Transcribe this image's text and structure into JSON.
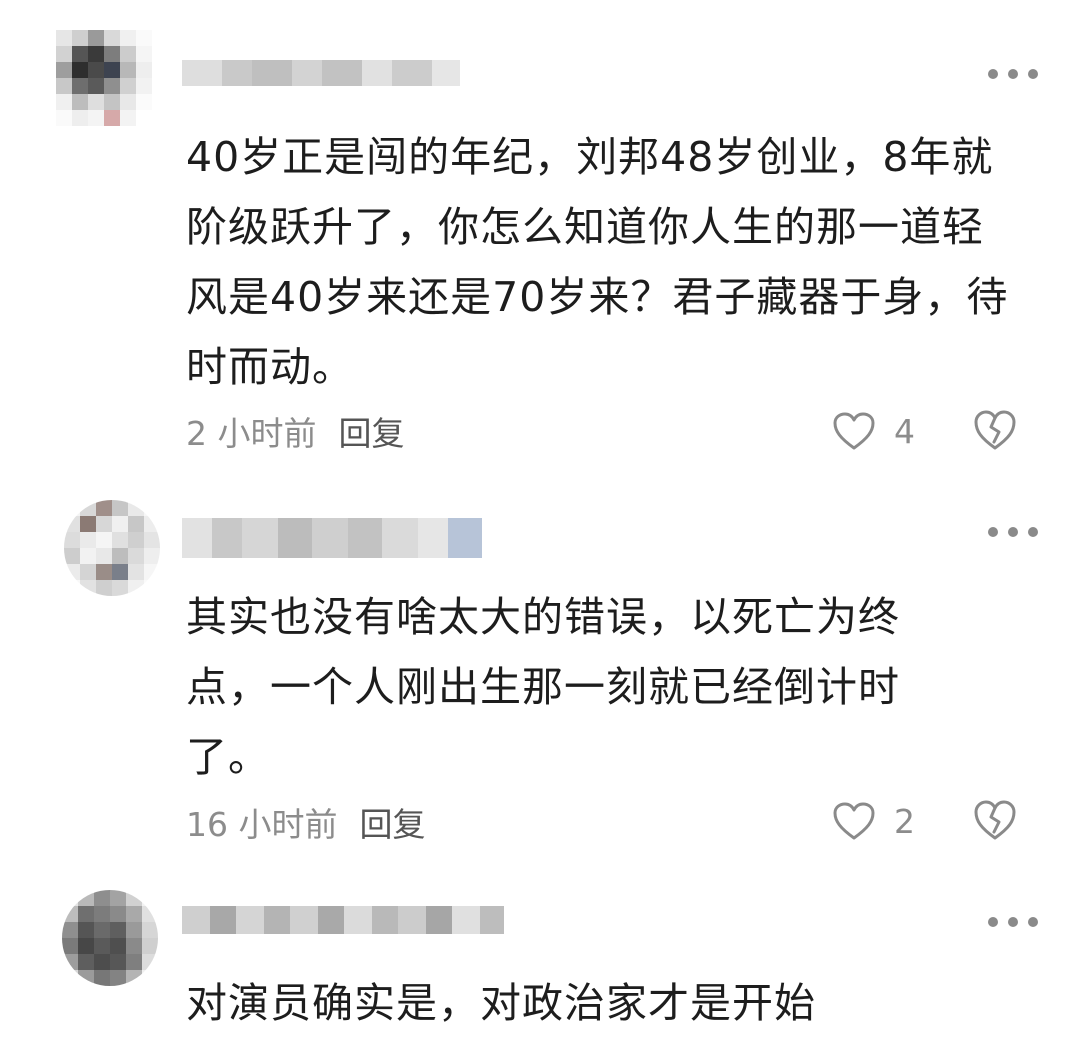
{
  "comments": [
    {
      "text": "40岁正是闯的年纪，刘邦48岁创业，8年就阶级跃升了，你怎么知道你人生的那一道轻风是40岁来还是70岁来？君子藏器于身，待时而动。",
      "time": "2 小时前",
      "reply_label": "回复",
      "likes": "4",
      "like_icon": "heart-outline-icon",
      "dislike_icon": "broken-heart-icon",
      "more_icon": "more-dots-icon"
    },
    {
      "text": "其实也没有啥太大的错误，以死亡为终点，一个人刚出生那一刻就已经倒计时了。",
      "time": "16 小时前",
      "reply_label": "回复",
      "likes": "2",
      "like_icon": "heart-outline-icon",
      "dislike_icon": "broken-heart-icon",
      "more_icon": "more-dots-icon"
    },
    {
      "text": "对演员确实是，对政治家才是开始",
      "more_icon": "more-dots-icon"
    }
  ],
  "colors": {
    "text": "#1d1d1d",
    "meta": "#8c8c8c",
    "icon": "#8a8a8a"
  }
}
